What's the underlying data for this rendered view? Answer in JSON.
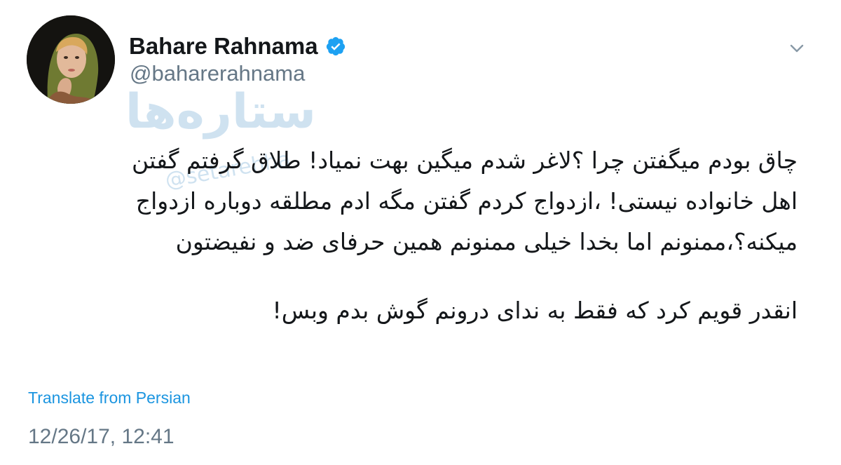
{
  "author": {
    "display_name": "Bahare Rahnama",
    "handle": "@baharerahnama",
    "verified_icon": "verified-badge-icon",
    "avatar_icon": "profile-photo"
  },
  "menu": {
    "icon": "chevron-down-icon"
  },
  "watermark": {
    "text": "ستاره‌ها",
    "subtext": "@setarehha"
  },
  "tweet": {
    "lines": [
      "چاق بودم میگفتن چرا ؟لاغر شدم میگین بهت نمیاد! طلاق گرفتم گفتن",
      "اهل خانواده نیستی! ،ازدواج کردم گفتن مگه ادم مطلقه دوباره ازدواج",
      "میکنه؟،ممنونم اما بخدا خیلی ممنونم همین حرفای ضد و نفیضتون",
      "انقدر قویم کرد که فقط به ندای درونم گوش بدم وبس!"
    ]
  },
  "translate_label": "Translate from Persian",
  "timestamp": "12/26/17, 12:41",
  "colors": {
    "link": "#1b95e0",
    "secondary": "#657786",
    "verified": "#1da1f2"
  }
}
